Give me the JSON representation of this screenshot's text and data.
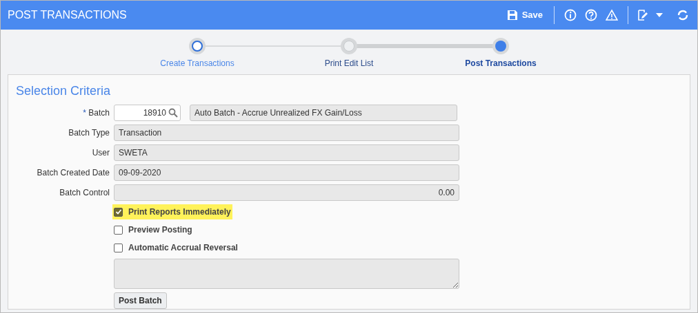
{
  "header": {
    "title": "POST TRANSACTIONS",
    "save_label": "Save"
  },
  "steps": [
    {
      "label": "Create Transactions",
      "completed": true,
      "selected": false
    },
    {
      "label": "Print Edit List",
      "completed": false,
      "selected": false
    },
    {
      "label": "Post Transactions",
      "completed": false,
      "selected": true
    }
  ],
  "section_title": "Selection Criteria",
  "batch": {
    "label": "Batch",
    "required_mark": "*",
    "value": "18910",
    "description": "Auto Batch - Accrue Unrealized FX Gain/Loss"
  },
  "fields": [
    {
      "label": "Batch Type",
      "value": "Transaction",
      "kind": "text"
    },
    {
      "label": "User",
      "value": "SWETA",
      "kind": "text"
    },
    {
      "label": "Batch Created Date",
      "value": "09-09-2020",
      "kind": "text"
    },
    {
      "label": "Batch Control",
      "value": "0.00",
      "kind": "amount"
    }
  ],
  "options": [
    {
      "label": "Print Reports Immediately",
      "checked": true,
      "highlighted": true
    },
    {
      "label": "Preview Posting",
      "checked": false,
      "highlighted": false
    },
    {
      "label": "Automatic Accrual Reversal",
      "checked": false,
      "highlighted": false
    }
  ],
  "post_button": "Post Batch"
}
